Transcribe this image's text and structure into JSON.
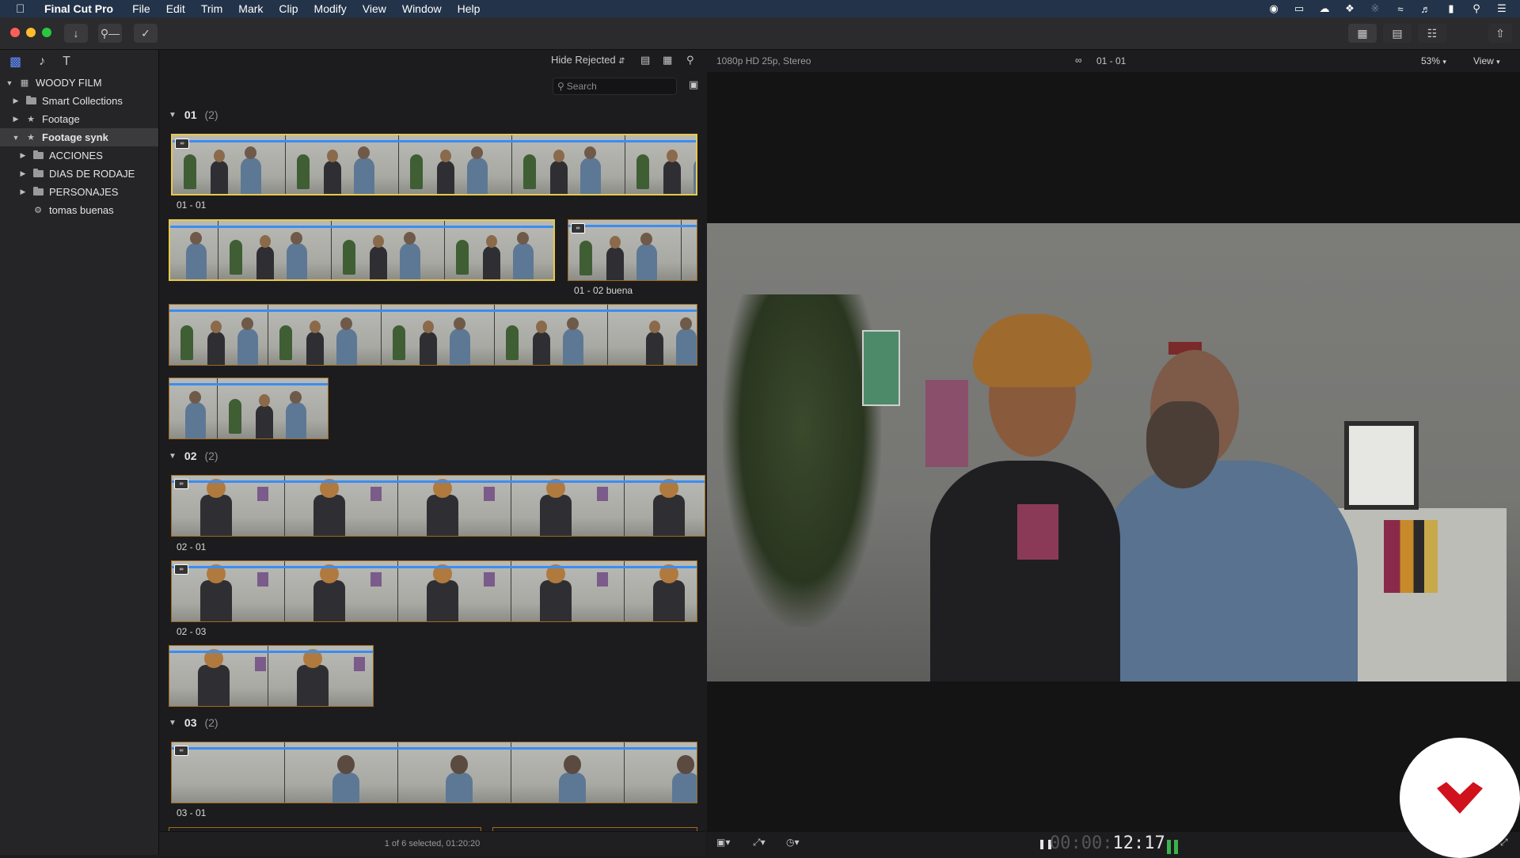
{
  "menubar": {
    "app_name": "Final Cut Pro",
    "items": [
      "File",
      "Edit",
      "Trim",
      "Mark",
      "Clip",
      "Modify",
      "View",
      "Window",
      "Help"
    ],
    "status_icons": [
      "record-icon",
      "display-icon",
      "cloud-icon",
      "dropbox-icon",
      "bluetooth-icon",
      "wifi-icon",
      "volume-icon",
      "battery-icon",
      "spotlight-icon",
      "list-icon"
    ]
  },
  "toolbar": {
    "buttons": [
      "import-icon",
      "keyword-icon",
      "background-tasks-icon"
    ],
    "right_buttons": [
      "browser-layout-icon",
      "timeline-layout-icon",
      "inspector-icon",
      "share-icon"
    ]
  },
  "sidebar": {
    "tabs": [
      "libraries-icon",
      "photos-audio-icon",
      "titles-generators-icon"
    ],
    "library": "WOODY FILM",
    "items": [
      {
        "label": "Smart Collections",
        "level": 1,
        "icon": "folder",
        "expanded": false
      },
      {
        "label": "Footage",
        "level": 1,
        "icon": "star",
        "expanded": false
      },
      {
        "label": "Footage synk",
        "level": 1,
        "icon": "star",
        "expanded": true,
        "selected": true
      },
      {
        "label": "ACCIONES",
        "level": 2,
        "icon": "folder",
        "expanded": false
      },
      {
        "label": "DIAS DE RODAJE",
        "level": 2,
        "icon": "folder",
        "expanded": false
      },
      {
        "label": "PERSONAJES",
        "level": 2,
        "icon": "folder",
        "expanded": false
      },
      {
        "label": "tomas buenas",
        "level": 2,
        "icon": "gear",
        "expanded": null
      }
    ]
  },
  "browser": {
    "filter": "Hide Rejected",
    "search_placeholder": "Search",
    "groups": [
      {
        "name": "01",
        "count": "(2)"
      },
      {
        "name": "02",
        "count": "(2)"
      },
      {
        "name": "03",
        "count": "(2)"
      }
    ],
    "clip_labels": {
      "c0101": "01 - 01",
      "c0102": "01 - 02 buena",
      "c0201": "02 - 01",
      "c0203": "02 - 03",
      "c0301": "03 - 01"
    },
    "status": "1 of 6 selected, 01:20:20"
  },
  "viewer": {
    "format": "1080p HD 25p, Stereo",
    "clip_name": "01 - 01",
    "zoom": "53%",
    "view_label": "View",
    "timecode_dim": "00:00:",
    "timecode": "12:17"
  }
}
